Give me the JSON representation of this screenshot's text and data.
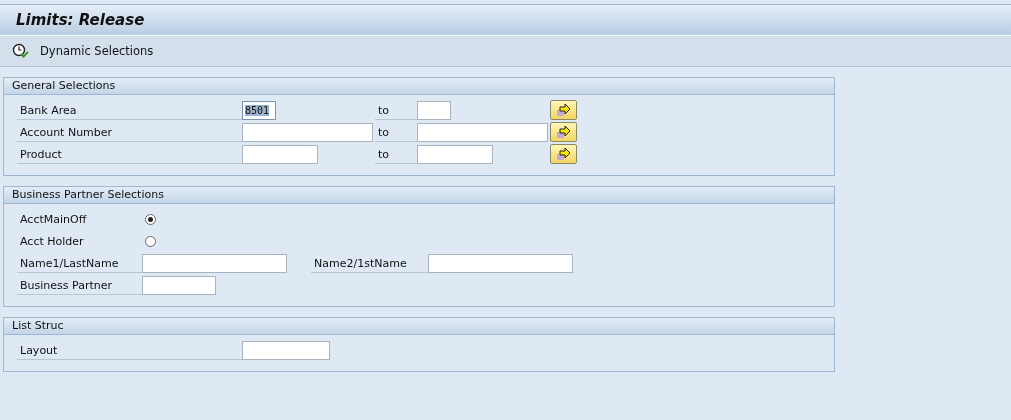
{
  "window": {
    "title": "Limits: Release"
  },
  "toolbar": [
    {
      "label": "Dynamic Selections"
    }
  ],
  "sections": [
    {
      "title": "General Selections",
      "kind": "ranges",
      "rows": [
        {
          "label": "Bank Area",
          "from": "8501",
          "from_selected": true,
          "to_label": "to"
        },
        {
          "label": "Account Number",
          "from_selected": false,
          "to_label": "to"
        },
        {
          "label": "Product",
          "from_selected": false,
          "to_label": "to"
        }
      ]
    },
    {
      "title": "Business Partner Selections",
      "kind": "partner",
      "rows": [
        {
          "kind": "radio",
          "label": "AcctMainOff",
          "selected": true
        },
        {
          "kind": "radio",
          "label": "Acct Holder",
          "selected": false
        },
        {
          "kind": "pair",
          "label": "Name1/LastName",
          "label2": "Name2/1stName"
        },
        {
          "kind": "field",
          "label": "Business Partner"
        }
      ]
    },
    {
      "title": "List Struc",
      "kind": "list",
      "rows": [
        {
          "label": "Layout"
        }
      ]
    }
  ]
}
